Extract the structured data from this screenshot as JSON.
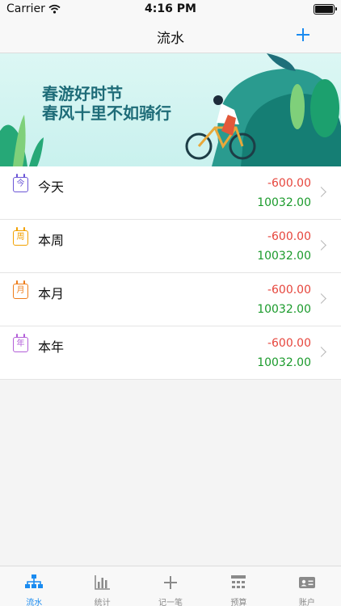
{
  "status_bar": {
    "carrier": "Carrier",
    "time": "4:16 PM"
  },
  "nav": {
    "title": "流水"
  },
  "banner": {
    "line1": "春游好时节",
    "line2": "春风十里不如骑行"
  },
  "rows": [
    {
      "icon": "calendar-today-icon",
      "icon_char": "今",
      "color": "#6b56d6",
      "label": "今天",
      "expense": "-600.00",
      "income": "10032.00"
    },
    {
      "icon": "calendar-week-icon",
      "icon_char": "周",
      "color": "#f2a100",
      "label": "本周",
      "expense": "-600.00",
      "income": "10032.00"
    },
    {
      "icon": "calendar-month-icon",
      "icon_char": "月",
      "color": "#ee7d1a",
      "label": "本月",
      "expense": "-600.00",
      "income": "10032.00"
    },
    {
      "icon": "calendar-year-icon",
      "icon_char": "年",
      "color": "#b35fd8",
      "label": "本年",
      "expense": "-600.00",
      "income": "10032.00"
    }
  ],
  "tabs": [
    {
      "label": "流水",
      "icon": "flow-tree-icon",
      "active": true
    },
    {
      "label": "统计",
      "icon": "bar-chart-icon",
      "active": false
    },
    {
      "label": "记一笔",
      "icon": "plus-icon",
      "active": false
    },
    {
      "label": "预算",
      "icon": "budget-grid-icon",
      "active": false
    },
    {
      "label": "账户",
      "icon": "id-card-icon",
      "active": false
    }
  ],
  "colors": {
    "accent": "#1a8bf0",
    "expense": "#e6453c",
    "income": "#1a9a2b",
    "inactive_tab": "#8a8a8a"
  }
}
